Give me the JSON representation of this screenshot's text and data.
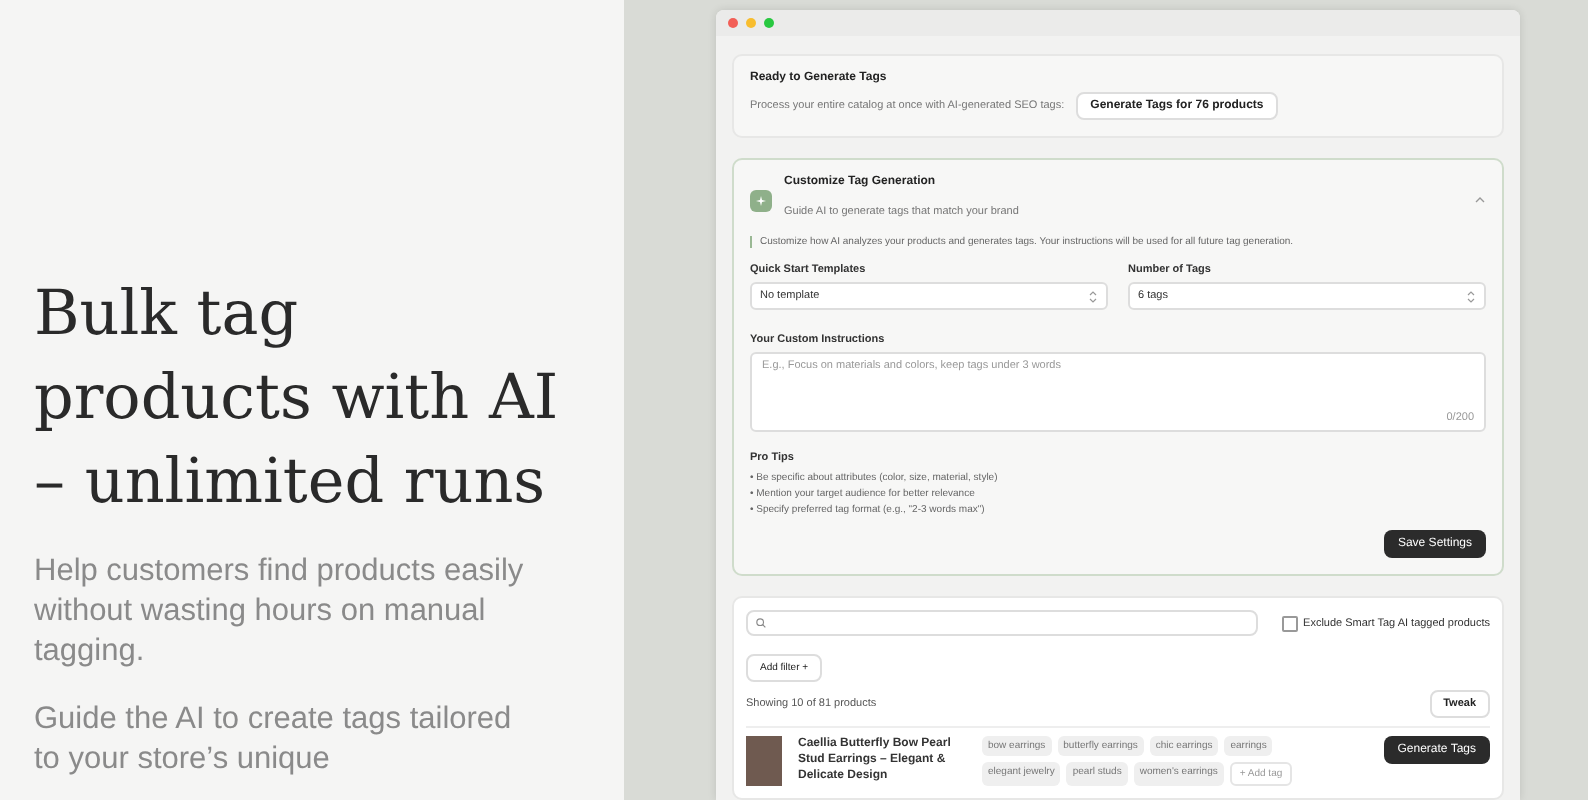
{
  "hero": {
    "headline": "Bulk tag products with AI – unlimited runs",
    "paragraphs": [
      "Help customers find products easily without wasting hours on manual tagging.",
      "Guide the AI to create tags tailored to your store’s unique"
    ]
  },
  "bulk": {
    "title": "Ready to Generate Tags",
    "text": "Process your entire catalog at once with AI-generated SEO tags:",
    "button": "Generate Tags for 76 products"
  },
  "customize": {
    "title": "Customize Tag Generation",
    "subtitle": "Guide AI to generate tags that match your brand",
    "expanded": true,
    "note": "Customize how AI analyzes your products and generates tags. Your instructions will be used for all future tag generation.",
    "selects": [
      {
        "label": "Quick Start Templates",
        "value": "No template"
      },
      {
        "label": "Number of Tags",
        "value": "6 tags"
      }
    ],
    "instructions": {
      "label": "Your Custom Instructions",
      "placeholder": "E.g., Focus on materials and colors, keep tags under 3 words",
      "counter": "0/200"
    },
    "tips_title": "Pro Tips",
    "tips": [
      "• Be specific about attributes (color, size, material, style)",
      "• Mention your target audience for better relevance",
      "• Specify preferred tag format (e.g., \"2-3 words max\")"
    ],
    "save": "Save Settings"
  },
  "products": {
    "exclude": {
      "label": "Exclude Smart Tag AI tagged products",
      "checked": false
    },
    "add_filter": "Add filter +",
    "showing": "Showing 10 of 81 products",
    "tweak": "Tweak",
    "rows": [
      {
        "name": "Caellia Butterfly Bow Pearl Stud Earrings – Elegant & Delicate Design",
        "tags": [
          "bow earrings",
          "butterfly earrings",
          "chic earrings",
          "earrings",
          "elegant jewelry",
          "pearl studs",
          "women's earrings"
        ],
        "add_tag": "+ Add tag",
        "button": "Generate Tags"
      }
    ]
  }
}
